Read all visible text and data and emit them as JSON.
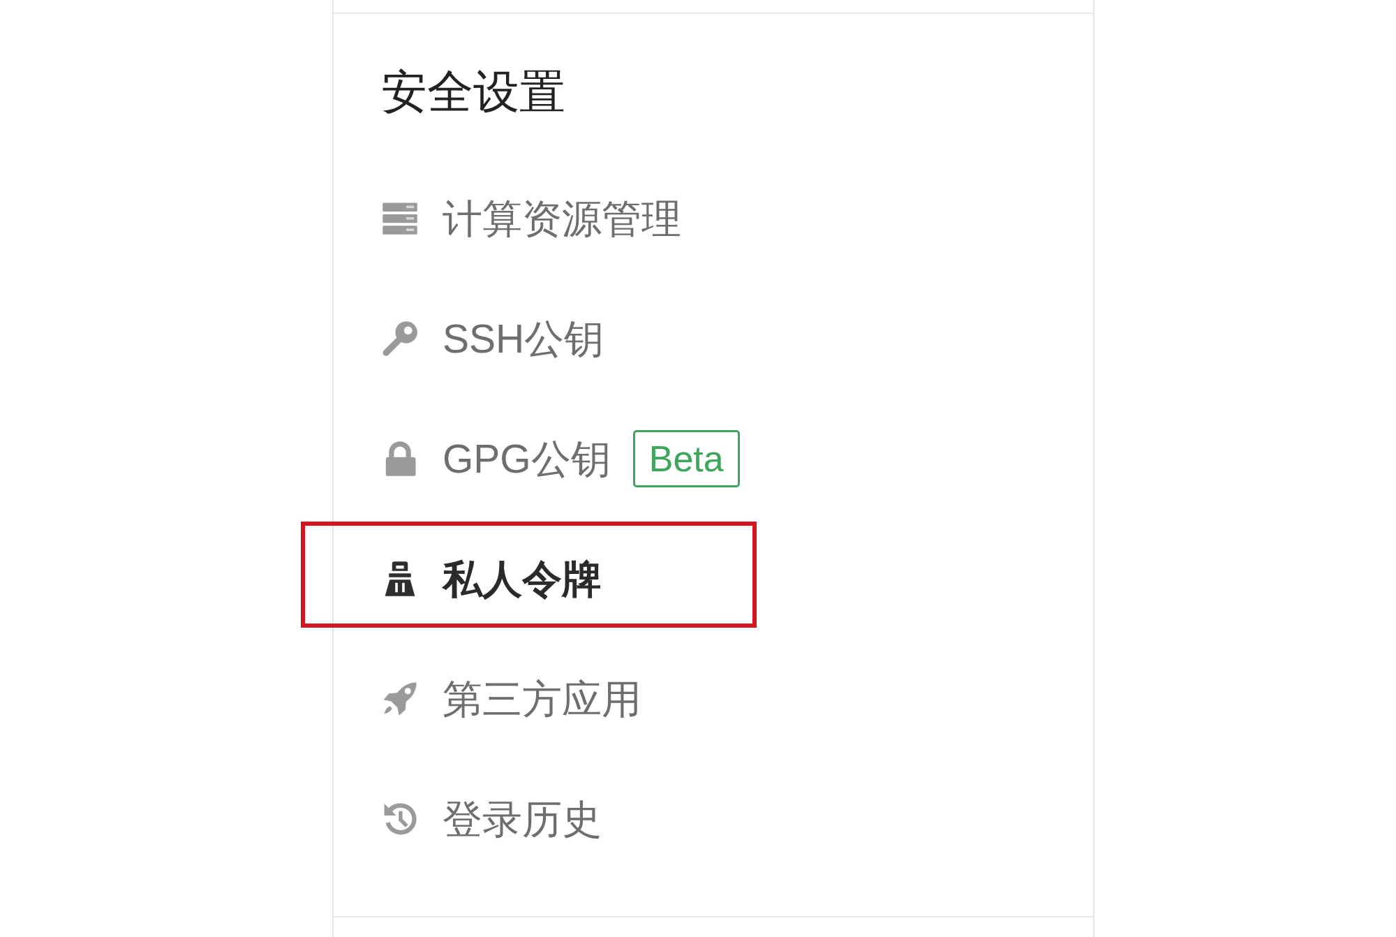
{
  "settings_panel": {
    "title": "安全设置",
    "items": [
      {
        "label": "计算资源管理",
        "selected": false,
        "annotated": false
      },
      {
        "label": "SSH公钥",
        "selected": false,
        "annotated": false
      },
      {
        "label": "GPG公钥",
        "badge": "Beta",
        "selected": false,
        "annotated": false
      },
      {
        "label": "私人令牌",
        "selected": true,
        "annotated": true
      },
      {
        "label": "第三方应用",
        "selected": false,
        "annotated": false
      },
      {
        "label": "登录历史",
        "selected": false,
        "annotated": false
      }
    ]
  }
}
